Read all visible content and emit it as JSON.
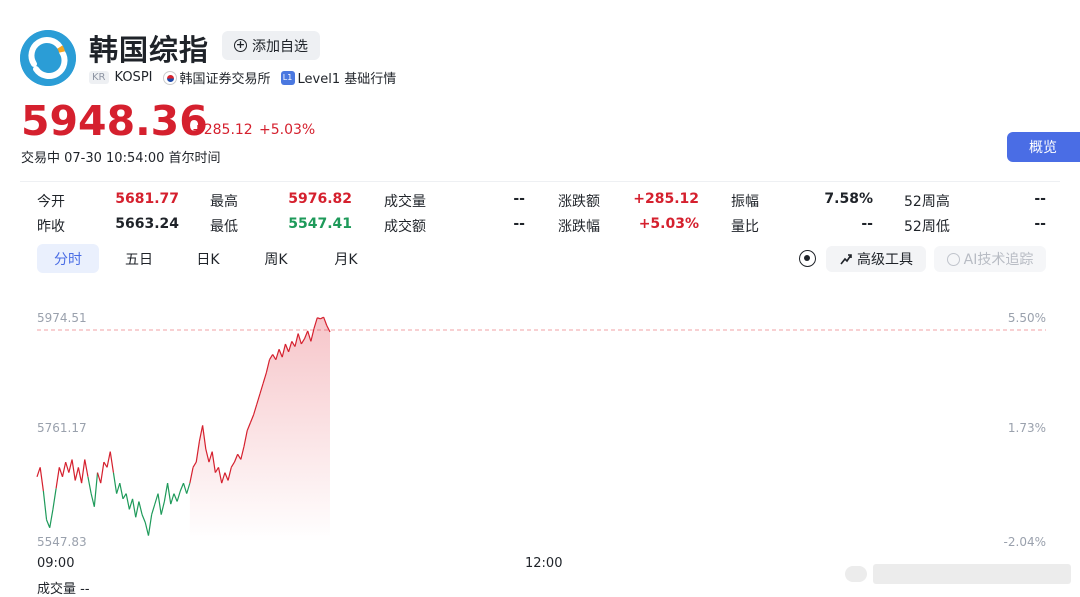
{
  "header": {
    "title": "韩国综指",
    "watch_label": "添加自选",
    "market_badge": "KR",
    "ticker": "KOSPI",
    "exchange": "韩国证券交易所",
    "level_badge": "L1",
    "level_label": "Level1 基础行情"
  },
  "quote": {
    "price": "5948.36",
    "change": "+285.12",
    "change_pct": "+5.03%",
    "status": "交易中 07-30 10:54:00 首尔时间"
  },
  "overview_button": "概览",
  "stats": {
    "open_label": "今开",
    "open": "5681.77",
    "high_label": "最高",
    "high": "5976.82",
    "volume_label": "成交量",
    "volume": "--",
    "chg_amt_label": "涨跌额",
    "chg_amt": "+285.12",
    "amplitude_label": "振幅",
    "amplitude": "7.58%",
    "w52_high_label": "52周高",
    "w52_high": "--",
    "prev_close_label": "昨收",
    "prev_close": "5663.24",
    "low_label": "最低",
    "low": "5547.41",
    "turnover_label": "成交额",
    "turnover": "--",
    "chg_pct_label": "涨跌幅",
    "chg_pct": "+5.03%",
    "vol_ratio_label": "量比",
    "vol_ratio": "--",
    "w52_low_label": "52周低",
    "w52_low": "--"
  },
  "tabs": [
    "分时",
    "五日",
    "日K",
    "周K",
    "月K"
  ],
  "tools": {
    "advanced": "高级工具",
    "ai_tracking": "AI技术追踪"
  },
  "colors": {
    "up": "#d5202e",
    "down": "#1e9a5a",
    "accent": "#4a6de5"
  },
  "chart_data": {
    "type": "line",
    "y_ticks": [
      "5974.51",
      "5761.17",
      "5547.83"
    ],
    "pct_ticks": [
      "5.50%",
      "1.73%",
      "-2.04%"
    ],
    "x_ticks": [
      "09:00",
      "12:00"
    ],
    "ylim": [
      5547.83,
      5974.51
    ],
    "reference_line": 5974.51,
    "prev_close": 5663.24,
    "volume_label": "成交量 --",
    "series": [
      {
        "values": [
          5672,
          5690,
          5645,
          5590,
          5575,
          5610,
          5650,
          5690,
          5672,
          5700,
          5680,
          5705,
          5665,
          5690,
          5660,
          5705,
          5672,
          5640,
          5615,
          5680,
          5660,
          5700,
          5690,
          5720,
          5680,
          5640,
          5660,
          5630,
          5640,
          5610,
          5630,
          5595,
          5625,
          5600,
          5585,
          5560,
          5600,
          5620,
          5640,
          5600,
          5625,
          5660,
          5620,
          5640,
          5625,
          5645,
          5660,
          5640,
          5660,
          5690,
          5700,
          5740,
          5770,
          5725,
          5700,
          5720,
          5680,
          5690,
          5660,
          5680,
          5665,
          5690,
          5700,
          5715,
          5705,
          5730,
          5760,
          5775,
          5790,
          5810,
          5830,
          5850,
          5870,
          5895,
          5905,
          5895,
          5915,
          5900,
          5925,
          5910,
          5930,
          5920,
          5945,
          5925,
          5935,
          5950,
          5930,
          5955,
          5975,
          5973,
          5976,
          5960,
          5948
        ]
      }
    ]
  }
}
